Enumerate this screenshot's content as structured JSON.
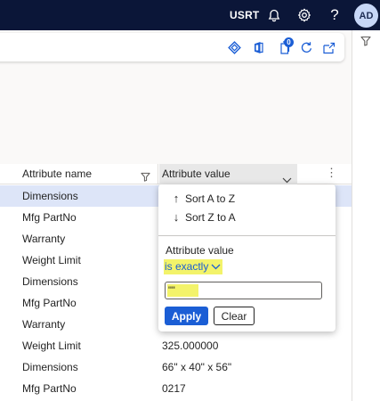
{
  "topbar": {
    "company": "USRT",
    "bell_icon": "bell-icon",
    "settings_icon": "gear-icon",
    "help_label": "?",
    "avatar_initials": "AD",
    "background": "#0b1638"
  },
  "action_pane": {
    "icons": [
      "diamond-icon",
      "office-icon",
      "attachments-icon",
      "refresh-icon",
      "open-in-new-icon"
    ],
    "attachments_count": "0"
  },
  "right_rail": {
    "icon": "filter-icon"
  },
  "grid": {
    "columns": [
      {
        "label": "Attribute name"
      },
      {
        "label": "Attribute value"
      }
    ],
    "more_label": "⋮",
    "rows": [
      {
        "name": "Dimensions",
        "value": "",
        "selected": true
      },
      {
        "name": "Mfg PartNo",
        "value": ""
      },
      {
        "name": "Warranty",
        "value": ""
      },
      {
        "name": "Weight Limit",
        "value": ""
      },
      {
        "name": "Dimensions",
        "value": ""
      },
      {
        "name": "Mfg PartNo",
        "value": ""
      },
      {
        "name": "Warranty",
        "value": ""
      },
      {
        "name": "Weight Limit",
        "value": "325.000000"
      },
      {
        "name": "Dimensions",
        "value": "66\" x 40\" x 56\""
      },
      {
        "name": "Mfg PartNo",
        "value": "0217"
      }
    ]
  },
  "filter_popup": {
    "sort_asc": {
      "arrow": "↑",
      "label": "Sort A to Z"
    },
    "sort_desc": {
      "arrow": "↓",
      "label": "Sort Z to A"
    },
    "field_label": "Attribute value",
    "operator": "is exactly",
    "value": "\"\"",
    "apply_label": "Apply",
    "clear_label": "Clear"
  },
  "colors": {
    "accent": "#1b5ed5",
    "highlight": "#f3f36a",
    "selected_row": "#dde5f8"
  }
}
